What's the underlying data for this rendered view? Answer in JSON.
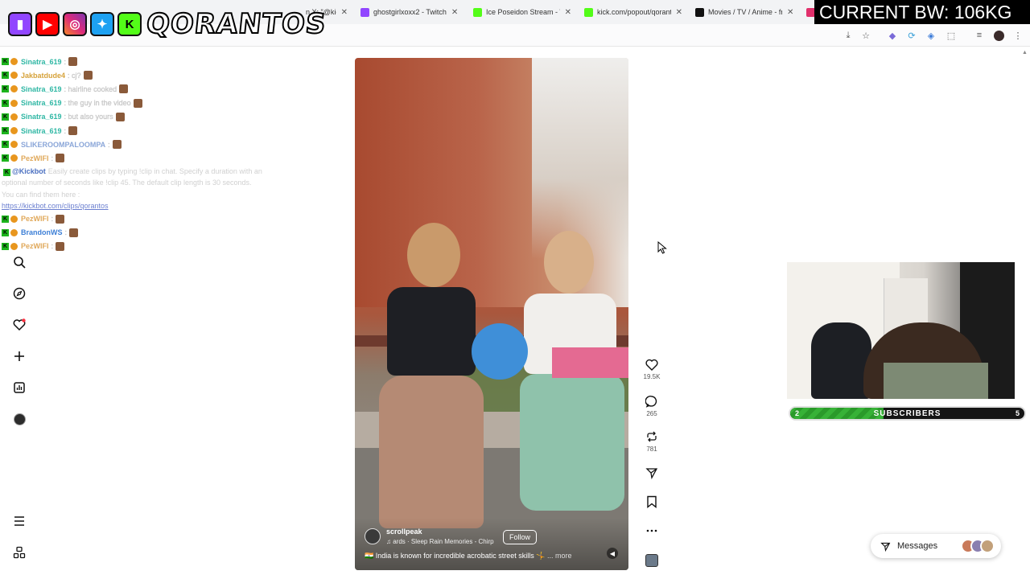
{
  "browser": {
    "tabs": [
      {
        "title": "n X: \"@kick",
        "icon_color": "#53fc18"
      },
      {
        "title": "ghostgirlxoxx2 - Twitch",
        "icon_color": "#9146ff"
      },
      {
        "title": "Ice Poseidon Stream - Wa",
        "icon_color": "#53fc18"
      },
      {
        "title": "kick.com/popout/qorant",
        "icon_color": "#53fc18"
      },
      {
        "title": "Movies / TV / Anime - fre",
        "icon_color": "#111111"
      },
      {
        "title": "",
        "icon_color": "#e1306c"
      }
    ],
    "close_glyph": "✕"
  },
  "overlay": {
    "brand": "QORANTOS",
    "bw_banner": "CURRENT BW: 106KG",
    "social_icons": [
      "twitch-icon",
      "youtube-icon",
      "instagram-icon",
      "twitter-icon",
      "kick-icon"
    ],
    "social_colors": [
      "#9146ff",
      "#ff0000",
      "#d62976",
      "#1da1f2",
      "#53fc18"
    ]
  },
  "chat": {
    "messages": [
      {
        "user": "Sinatra_619",
        "text": ":",
        "color": "#2fb7a4"
      },
      {
        "user": "Jakbatdude4",
        "text": ": cj?",
        "color": "#d6a23a"
      },
      {
        "user": "Sinatra_619",
        "text": ": hairline cooked",
        "color": "#2fb7a4"
      },
      {
        "user": "Sinatra_619",
        "text": ": the guy in the video",
        "color": "#2fb7a4"
      },
      {
        "user": "Sinatra_619",
        "text": ": but also yours",
        "color": "#2fb7a4"
      },
      {
        "user": "Sinatra_619",
        "text": ":",
        "color": "#2fb7a4"
      },
      {
        "user": "SLIKEROOMPALOOMPA",
        "text": ":",
        "color": "#8aa6d8"
      },
      {
        "user": "PezWIFI",
        "text": ":",
        "color": "#e0a85a"
      }
    ],
    "bot": {
      "user": "@Kickbot",
      "text": "Easily create clips by typing !clip in chat. Specify a duration with an optional number of seconds like !clip 45. The default clip length is 30 seconds. You can find them here :",
      "link": "https://kickbot.com/clips/qorantos"
    },
    "messages_after": [
      {
        "user": "PezWIFI",
        "text": ": ",
        "color": "#e0a85a"
      },
      {
        "user": "BrandonWS",
        "text": ":",
        "color": "#3d7fd6"
      },
      {
        "user": "PezWIFI",
        "text": ":",
        "color": "#e0a85a"
      }
    ]
  },
  "sidebar": {
    "icons": [
      "search-icon",
      "explore-icon",
      "notifications-icon",
      "create-icon",
      "dashboard-icon",
      "profile-icon",
      "menu-icon",
      "more-icon"
    ]
  },
  "reel": {
    "username": "scrollpeak",
    "audio": "ards · Sleep Rain Memories - Chirp",
    "follow_label": "Follow",
    "caption": "🇮🇳 India is known for incredible acrobatic street skills 🤸",
    "more_label": "... more"
  },
  "actions": {
    "like_count": "19.5K",
    "comment_count": "265",
    "repost_count": "781"
  },
  "subscribers": {
    "label": "SUBSCRIBERS",
    "current": "2",
    "goal": "5",
    "progress": 0.4
  },
  "messages": {
    "label": "Messages",
    "avatar_colors": [
      "#c97a5a",
      "#8a7fb0",
      "#c2a07a"
    ]
  }
}
